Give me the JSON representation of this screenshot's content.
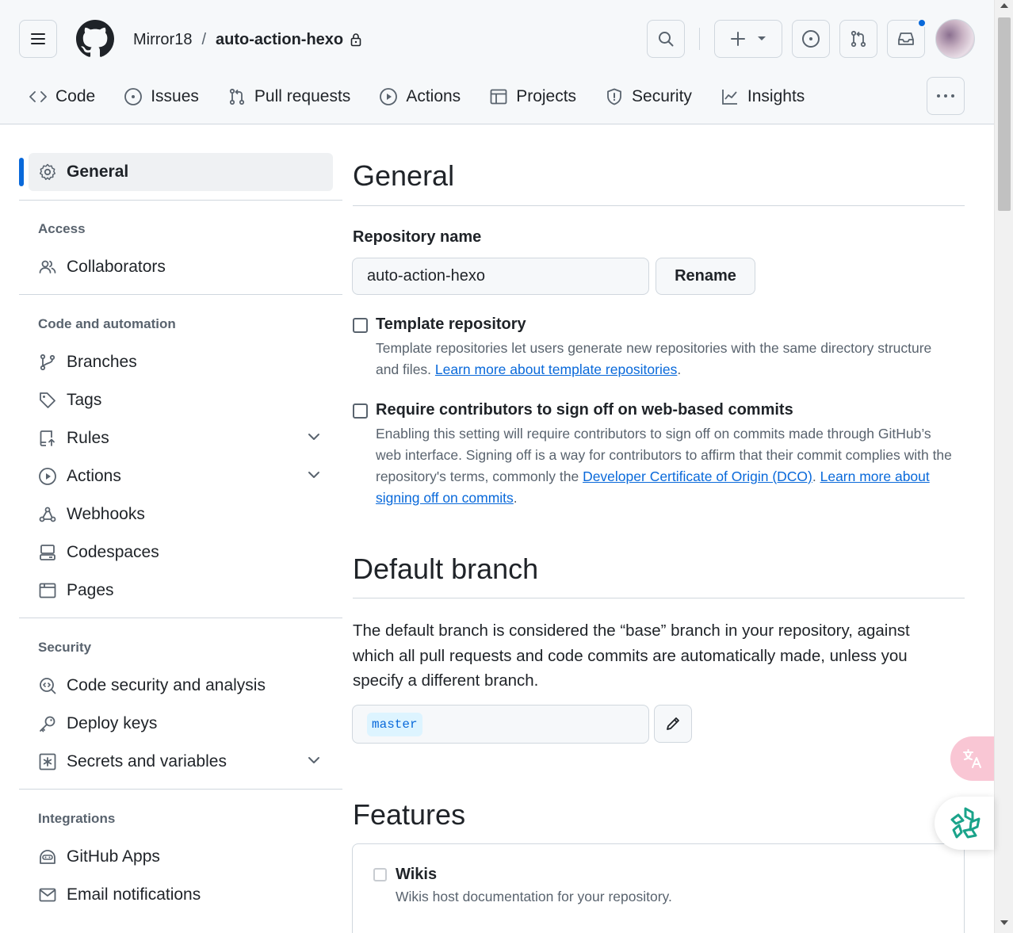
{
  "header": {
    "owner": "Mirror18",
    "separator": "/",
    "repo": "auto-action-hexo",
    "icons": [
      "hamburger-icon",
      "github-logo-icon",
      "lock-icon",
      "search-icon",
      "plus-icon",
      "triangle-down-icon",
      "issue-opened-icon",
      "git-pull-request-icon",
      "inbox-icon",
      "avatar"
    ],
    "notification_dot_color": "#0969da"
  },
  "tabs": [
    {
      "label": "Code",
      "icon": "code-icon"
    },
    {
      "label": "Issues",
      "icon": "issue-opened-icon"
    },
    {
      "label": "Pull requests",
      "icon": "git-pull-request-icon"
    },
    {
      "label": "Actions",
      "icon": "play-icon"
    },
    {
      "label": "Projects",
      "icon": "table-icon"
    },
    {
      "label": "Security",
      "icon": "shield-icon"
    },
    {
      "label": "Insights",
      "icon": "graph-icon"
    }
  ],
  "sidebar": {
    "general": "General",
    "groups": {
      "access": "Access",
      "code_automation": "Code and automation",
      "security": "Security",
      "integrations": "Integrations"
    },
    "items": {
      "collaborators": "Collaborators",
      "branches": "Branches",
      "tags": "Tags",
      "rules": "Rules",
      "actions": "Actions",
      "webhooks": "Webhooks",
      "codespaces": "Codespaces",
      "pages": "Pages",
      "code_security": "Code security and analysis",
      "deploy_keys": "Deploy keys",
      "secrets": "Secrets and variables",
      "github_apps": "GitHub Apps",
      "email_notifications": "Email notifications"
    }
  },
  "main": {
    "title": "General",
    "repo_name_label": "Repository name",
    "repo_name_value": "auto-action-hexo",
    "rename_label": "Rename",
    "template": {
      "checked": false,
      "title": "Template repository",
      "desc_before": "Template repositories let users generate new repositories with the same directory structure and files. ",
      "link": "Learn more about template repositories",
      "desc_after": "."
    },
    "signoff": {
      "checked": false,
      "title": "Require contributors to sign off on web-based commits",
      "desc_before": "Enabling this setting will require contributors to sign off on commits made through GitHub’s web interface. Signing off is a way for contributors to affirm that their commit complies with the repository's terms, commonly the ",
      "link1": "Developer Certificate of Origin (DCO)",
      "mid": ". ",
      "link2": "Learn more about signing off on commits",
      "desc_after": "."
    },
    "default_branch": {
      "title": "Default branch",
      "desc": "The default branch is considered the “base” branch in your repository, against which all pull requests and code commits are automatically made, unless you specify a different branch.",
      "branch": "master"
    },
    "features": {
      "title": "Features",
      "wikis": {
        "checked": false,
        "title": "Wikis",
        "desc": "Wikis host documentation for your repository."
      }
    }
  },
  "colors": {
    "accent": "#0969da",
    "header_bg": "#f6f8fa",
    "border": "#d0d7de",
    "muted": "#59636e"
  }
}
